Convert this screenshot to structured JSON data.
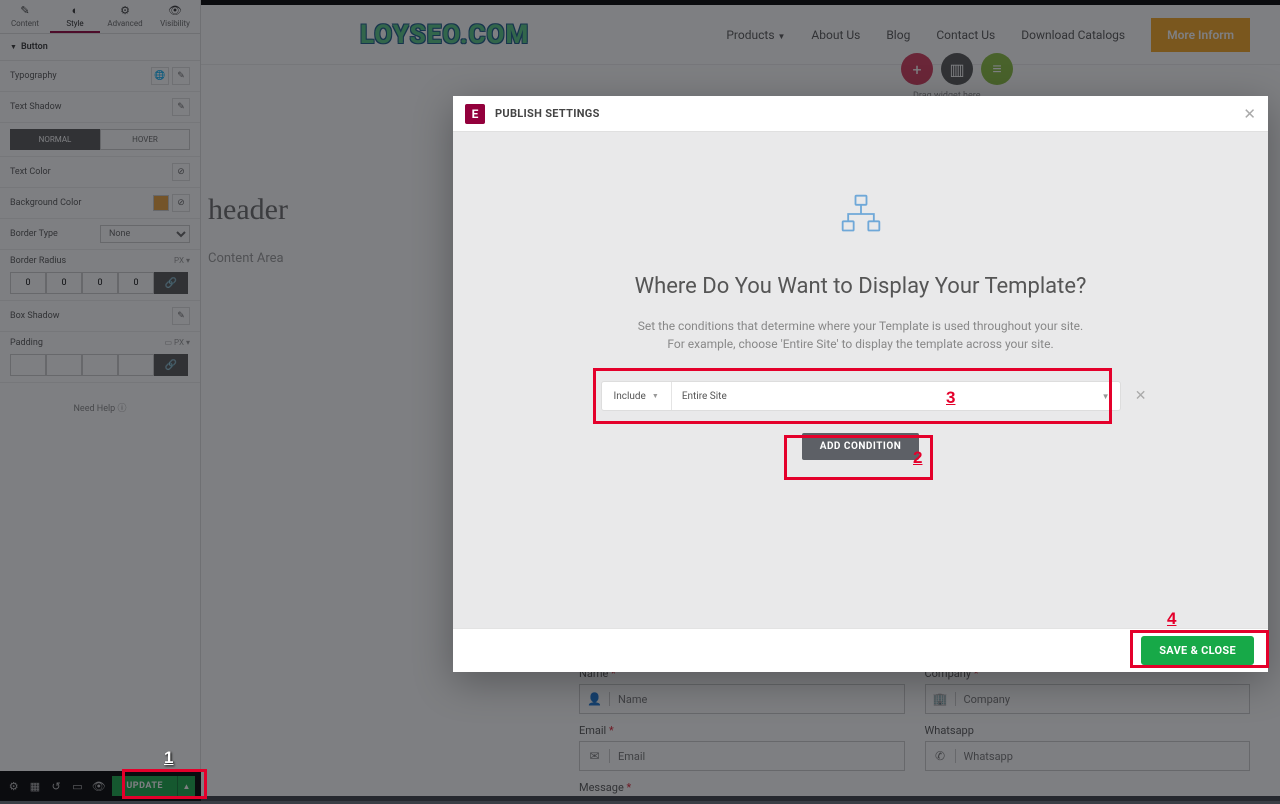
{
  "watermark": "LOYSEO.COM",
  "sidepanel": {
    "tabs": {
      "content": "Content",
      "style": "Style",
      "advanced": "Advanced",
      "visibility": "Visibility"
    },
    "section": "Button",
    "rows": {
      "typography": "Typography",
      "text_shadow": "Text Shadow",
      "toggle_normal": "NORMAL",
      "toggle_hover": "HOVER",
      "text_color": "Text Color",
      "bg_color": "Background Color",
      "border_type": "Border Type",
      "border_type_val": "None",
      "border_radius": "Border Radius",
      "box_shadow": "Box Shadow",
      "padding": "Padding"
    },
    "radius": [
      "0",
      "0",
      "0",
      "0"
    ],
    "help": "Need Help ⓘ",
    "update": "UPDATE"
  },
  "site": {
    "nav": {
      "products": "Products",
      "about": "About Us",
      "blog": "Blog",
      "contact": "Contact Us",
      "download": "Download Catalogs"
    },
    "more_info": "More Inform",
    "header_label": "header",
    "content_area": "Content Area",
    "drag_widget": "Drag widget here",
    "form": {
      "name": "Name",
      "company": "Company",
      "email": "Email",
      "whatsapp": "Whatsapp",
      "message": "Message",
      "ph_name": "Name",
      "ph_company": "Company",
      "ph_email": "Email",
      "ph_whatsapp": "Whatsapp"
    }
  },
  "modal": {
    "title": "PUBLISH SETTINGS",
    "heading": "Where Do You Want to Display Your Template?",
    "sub1": "Set the conditions that determine where your Template is used throughout your site.",
    "sub2": "For example, choose 'Entire Site' to display the template across your site.",
    "include": "Include",
    "entire_site": "Entire Site",
    "add_condition": "ADD CONDITION",
    "save_close": "SAVE & CLOSE"
  },
  "anno": {
    "n1": "1",
    "n2": "2",
    "n3": "3",
    "n4": "4"
  }
}
